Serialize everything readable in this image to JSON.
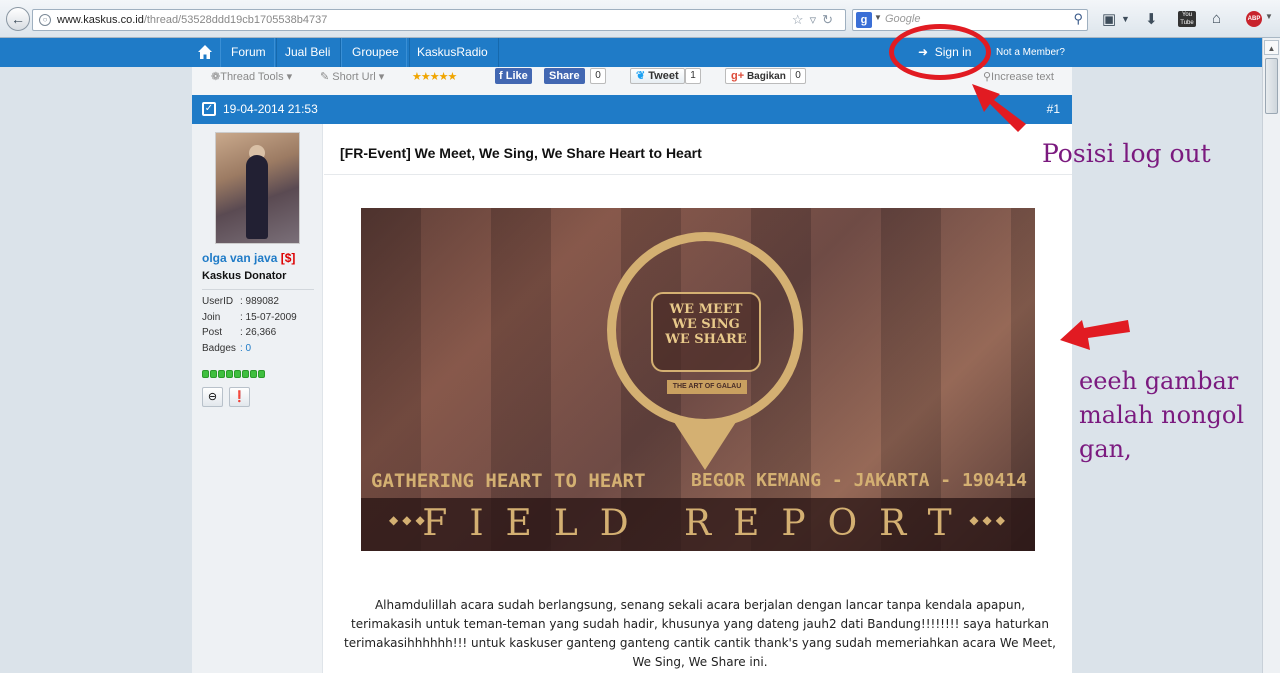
{
  "browser": {
    "url_host": "www.kaskus.co.id",
    "url_path": "/thread/53528ddd19cb1705538b4737",
    "search_placeholder": "Google"
  },
  "topnav": {
    "items": [
      "Forum",
      "Jual Beli",
      "Groupee",
      "KaskusRadio"
    ],
    "sign_in": "Sign in",
    "not_member": "Not a Member?"
  },
  "tools": {
    "thread_tools": "Thread Tools",
    "short_url": "Short Url",
    "fb_like": "Like",
    "fb_share": "Share",
    "fb_count": "0",
    "tweet": "Tweet",
    "tweet_count": "1",
    "gplus": "Bagikan",
    "gplus_count": "0",
    "increase_text": "Increase text"
  },
  "post": {
    "date": "19-04-2014 21:53",
    "number": "#1",
    "title": "[FR-Event] We Meet, We Sing, We Share Heart to Heart",
    "body": "Alhamdulillah acara sudah berlangsung, senang sekali acara berjalan dengan lancar tanpa kendala apapun, terimakasih untuk teman-teman yang sudah hadir, khusunya yang dateng jauh2 dati Bandung!!!!!!!! saya haturkan terimakasihhhhhh!!! untuk kaskuser ganteng ganteng cantik cantik thank's yang sudah memeriahkan acara We Meet, We Sing, We Share ini."
  },
  "user": {
    "name": "olga van java",
    "donator_tag": "[$]",
    "title": "Kaskus Donator",
    "stats": [
      {
        "key": "UserID",
        "value": ": 989082"
      },
      {
        "key": "Join",
        "value": ": 15-07-2009"
      },
      {
        "key": "Post",
        "value": ": 26,366"
      },
      {
        "key": "Badges",
        "value": ": 0"
      }
    ]
  },
  "banner": {
    "logo_line1": "WE MEET",
    "logo_line2": "WE SING",
    "logo_line3": "WE SHARE",
    "logo_sub": "THE ART OF GALAU",
    "left_caption": "GATHERING HEART TO HEART",
    "right_caption": "BEGOR KEMANG - JAKARTA - 190414",
    "report_text": "FIELD REPORT"
  },
  "annotations": {
    "label1": "Posisi log out",
    "label2": "eeeh gambar malah nongol gan,"
  },
  "colors": {
    "kaskus_blue": "#1f7bc7",
    "annotation_red": "#e11b22",
    "annotation_purple": "#7b1a7f",
    "banner_gold": "#d4b072"
  }
}
